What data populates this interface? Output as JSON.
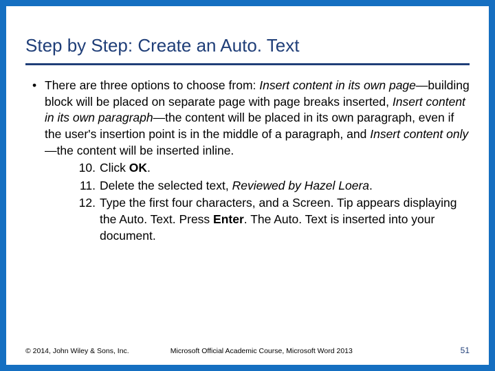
{
  "title": "Step by Step: Create an Auto. Text",
  "intro_plain1": "There are three options to choose from: ",
  "intro_em1": "Insert content in its own page",
  "intro_plain2": "—building block will be placed on separate page with page breaks inserted, ",
  "intro_em2": "Insert content in its own paragraph",
  "intro_plain3": "—the content will be placed in its own paragraph, even if the user's insertion point is in the middle of a paragraph, and ",
  "intro_em3": "Insert content only",
  "intro_plain4": "—the content will be inserted inline.",
  "steps": {
    "s10": {
      "num": "10.",
      "a": "Click ",
      "b": "OK",
      "c": "."
    },
    "s11": {
      "num": "11.",
      "a": "Delete the selected text, ",
      "b": "Reviewed by Hazel Loera",
      "c": "."
    },
    "s12": {
      "num": "12.",
      "a": "Type the first four characters, and a Screen. Tip appears displaying the Auto. Text. Press ",
      "b": "Enter",
      "c": ". The Auto. Text is inserted into your document."
    }
  },
  "footer": {
    "copyright": "© 2014, John Wiley & Sons, Inc.",
    "course": "Microsoft Official Academic Course, Microsoft Word 2013",
    "page": "51"
  }
}
